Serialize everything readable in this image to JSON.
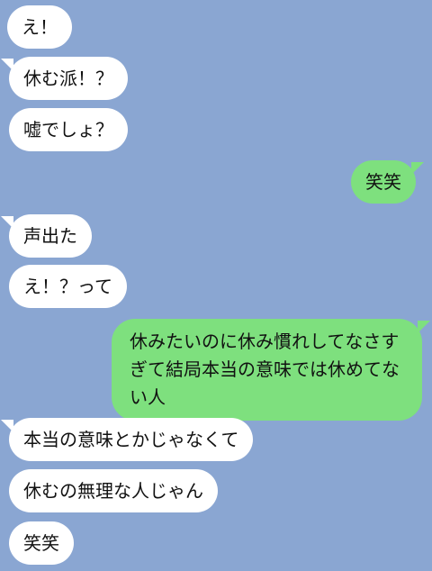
{
  "colors": {
    "background": "#8aa6d2",
    "incoming_bubble": "#ffffff",
    "outgoing_bubble": "#7ee07e",
    "text": "#111111"
  },
  "messages": [
    {
      "side": "left",
      "text": "え！"
    },
    {
      "side": "left",
      "text": "休む派！？"
    },
    {
      "side": "left",
      "text": "嘘でしょ？"
    },
    {
      "side": "right",
      "text": "笑笑"
    },
    {
      "side": "left",
      "text": "声出た"
    },
    {
      "side": "left",
      "text": "え！？って"
    },
    {
      "side": "right",
      "text": "休みたいのに休み慣れしてなさすぎて結局本当の意味では休めてない人"
    },
    {
      "side": "left",
      "text": "本当の意味とかじゃなくて"
    },
    {
      "side": "left",
      "text": "休むの無理な人じゃん"
    },
    {
      "side": "left",
      "text": "笑笑"
    }
  ]
}
